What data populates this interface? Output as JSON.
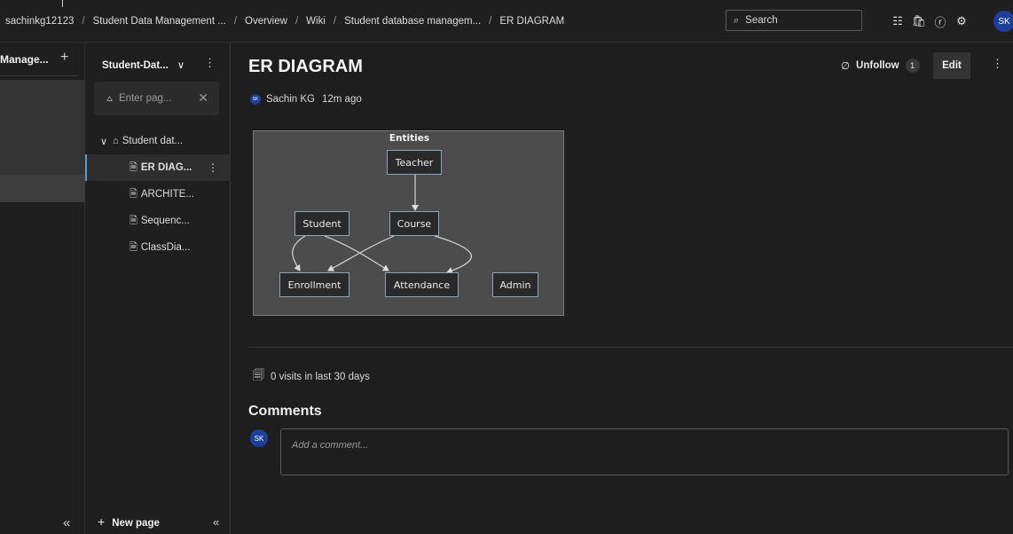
{
  "breadcrumb": {
    "items": [
      "sachinkg12123",
      "Student Data Management ...",
      "Overview",
      "Wiki",
      "Student database managem...",
      "ER DIAGRAM"
    ],
    "separator": "/"
  },
  "search": {
    "placeholder": "Search",
    "icon": "search-icon"
  },
  "top_icons": [
    "task-list-icon",
    "marketplace-icon",
    "help-icon",
    "user-settings-icon"
  ],
  "user": {
    "initials": "SK",
    "avatar_color": "#1d3f9a"
  },
  "project_rail": {
    "title": "Manage...",
    "add_symbol": "+",
    "collapse_symbol": "«"
  },
  "wiki_tree": {
    "title": "Student-Dat...",
    "dropdown_symbol": "∨",
    "more_symbol": "⋮",
    "filter_placeholder": "Enter pag...",
    "filter_clear": "✕",
    "root": {
      "label": "Student dat...",
      "icon": "home-icon"
    },
    "pages": [
      {
        "label": "ER DIAG...",
        "selected": true
      },
      {
        "label": "ARCHITE...",
        "selected": false
      },
      {
        "label": "Sequenc...",
        "selected": false
      },
      {
        "label": "ClassDia...",
        "selected": false
      }
    ],
    "new_page_label": "New page",
    "collapse_symbol": "«",
    "selection_color": "#4aa0e6"
  },
  "page": {
    "title": "ER DIAGRAM",
    "author": "Sachin KG",
    "author_initials": "SK",
    "time": "12m ago",
    "unfollow_label": "Unfollow",
    "follower_count": "1",
    "edit_label": "Edit",
    "more_symbol": "⋮"
  },
  "diagram": {
    "group_title": "Entities",
    "nodes": [
      "Teacher",
      "Student",
      "Course",
      "Enrollment",
      "Attendance",
      "Admin"
    ],
    "edges": [
      [
        "Teacher",
        "Course"
      ],
      [
        "Student",
        "Enrollment"
      ],
      [
        "Student",
        "Attendance"
      ],
      [
        "Course",
        "Enrollment"
      ],
      [
        "Course",
        "Attendance"
      ]
    ]
  },
  "stats": {
    "visits_text": "0 visits in last 30 days"
  },
  "comments": {
    "title": "Comments",
    "placeholder": "Add a comment...",
    "avatar_initials": "SK"
  }
}
